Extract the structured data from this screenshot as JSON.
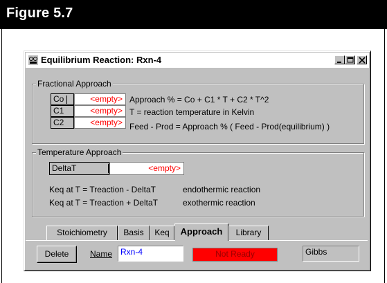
{
  "figure": {
    "title": "Figure 5.7"
  },
  "window": {
    "title": "Equilibrium Reaction: Rxn-4",
    "controls": [
      "minimize",
      "maximize",
      "close"
    ]
  },
  "fractional": {
    "group_label": "Fractional Approach",
    "rows": [
      {
        "label": "Co",
        "value": "<empty>"
      },
      {
        "label": "C1",
        "value": "<empty>"
      },
      {
        "label": "C2",
        "value": "<empty>"
      }
    ],
    "formula": "Approach % = Co + C1 * T + C2 * T^2",
    "t_desc": "T = reaction temperature in Kelvin",
    "feed_desc": "Feed - Prod = Approach % ( Feed - Prod(equilibrium) )"
  },
  "temperature": {
    "group_label": "Temperature Approach",
    "label": "DeltaT",
    "value": "<empty>",
    "keq_endo_formula": "Keq at T = Treaction  - DeltaT",
    "keq_endo_desc": "endothermic reaction",
    "keq_exo_formula": "Keq at T = Treaction + DeltaT",
    "keq_exo_desc": "exothermic reaction"
  },
  "tabs": [
    {
      "label": "Stoichiometry",
      "active": false
    },
    {
      "label": "Basis",
      "active": false
    },
    {
      "label": "Keq",
      "active": false
    },
    {
      "label": "Approach",
      "active": true
    },
    {
      "label": "Library",
      "active": false
    }
  ],
  "footer": {
    "delete_label": "Delete",
    "name_label": "Name",
    "name_value": "Rxn-4",
    "status_text": "Not Ready",
    "status_color": "#ff0000",
    "package_value": "Gibbs"
  }
}
